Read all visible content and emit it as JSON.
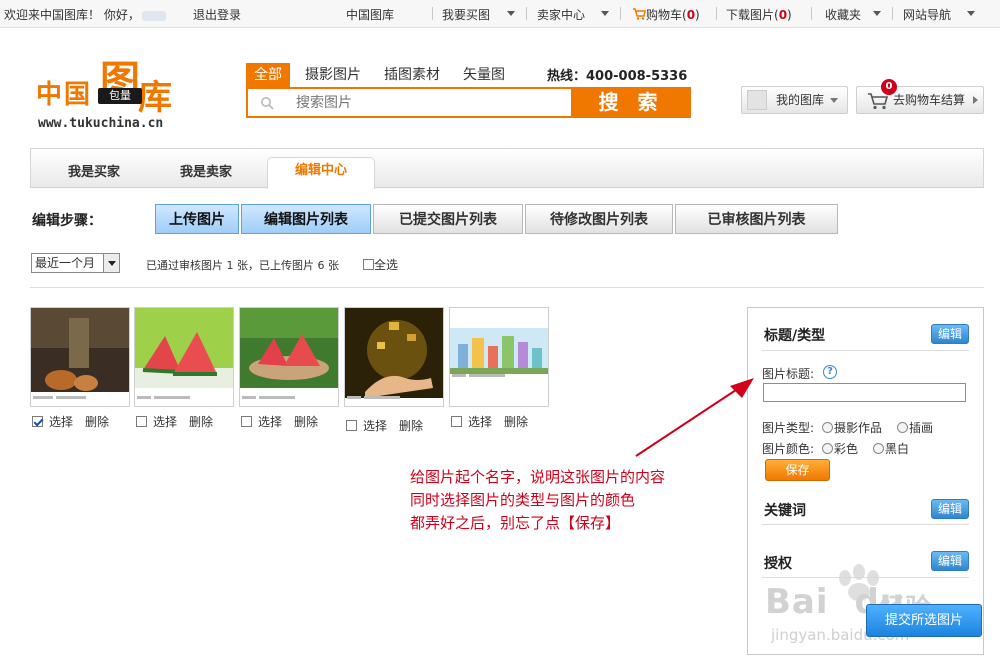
{
  "topbar": {
    "welcome": "欢迎来中国图库！",
    "hello": "你好，",
    "logout": "退出登录",
    "nav": {
      "home": "中国图库",
      "buy": "我要买图",
      "seller": "卖家中心",
      "cart_label": "购物车(",
      "cart_count": "0",
      "download_label": "下载图片(",
      "download_count": "0",
      "close": ")",
      "favorites": "收藏夹",
      "sitenav": "网站导航"
    }
  },
  "logo": {
    "text_left": "中国",
    "text_tu": "图",
    "text_ku": "库",
    "badge": "包量",
    "url": "www.tukuchina.cn"
  },
  "search": {
    "tabs": [
      "全部",
      "摄影图片",
      "插图素材",
      "矢量图"
    ],
    "active_tab": "全部",
    "hotline_label": "热线：",
    "hotline_number": "400-008-5336",
    "placeholder": "搜索图片",
    "button": "搜 索"
  },
  "header_buttons": {
    "my_library": "我的图库",
    "cart_checkout": "去购物车结算",
    "cart_badge": "0"
  },
  "main_tabs": [
    "我是买家",
    "我是卖家",
    "编辑中心"
  ],
  "active_main_tab": "编辑中心",
  "steps": {
    "label": "编辑步骤：",
    "items": [
      "上传图片",
      "编辑图片列表",
      "已提交图片列表",
      "待修改图片列表",
      "已审核图片列表"
    ],
    "highlighted": [
      "上传图片",
      "编辑图片列表"
    ]
  },
  "filter": {
    "range_selected": "最近一个月",
    "summary": "已通过审核图片 1 张，已上传图片 6 张",
    "select_all": "全选"
  },
  "thumbnails": [
    {
      "subject": "food-dark",
      "checked": true,
      "select": "选择",
      "delete": "删除"
    },
    {
      "subject": "watermelon-green",
      "checked": false,
      "select": "选择",
      "delete": "删除"
    },
    {
      "subject": "watermelon-plate",
      "checked": false,
      "select": "选择",
      "delete": "删除"
    },
    {
      "subject": "hand-gold",
      "checked": false,
      "select": "选择",
      "delete": "删除"
    },
    {
      "subject": "city-illustration",
      "checked": false,
      "select": "选择",
      "delete": "删除"
    }
  ],
  "panel": {
    "section_title_type": "标题/类型",
    "edit": "编辑",
    "title_label": "图片标题:",
    "help": "?",
    "type_label": "图片类型:",
    "type_options": [
      "摄影作品",
      "插画"
    ],
    "color_label": "图片颜色:",
    "color_options": [
      "彩色",
      "黑白"
    ],
    "save": "保存",
    "keywords_title": "关键词",
    "license_title": "授权"
  },
  "submit_button": "提交所选图片",
  "annotation": [
    "给图片起个名字，说明这张图片的内容",
    "同时选择图片的类型与图片的颜色",
    "都弄好之后，别忘了点【保存】"
  ],
  "watermark": {
    "brand": "Bai",
    "brand2": "du",
    "jingyan": "经验",
    "url": "jingyan.baidu.com"
  },
  "colors": {
    "accent_orange": "#f07800",
    "step_blue": "#9fcdf7",
    "button_blue": "#2f86cf",
    "annotation_red": "#d0021b"
  }
}
